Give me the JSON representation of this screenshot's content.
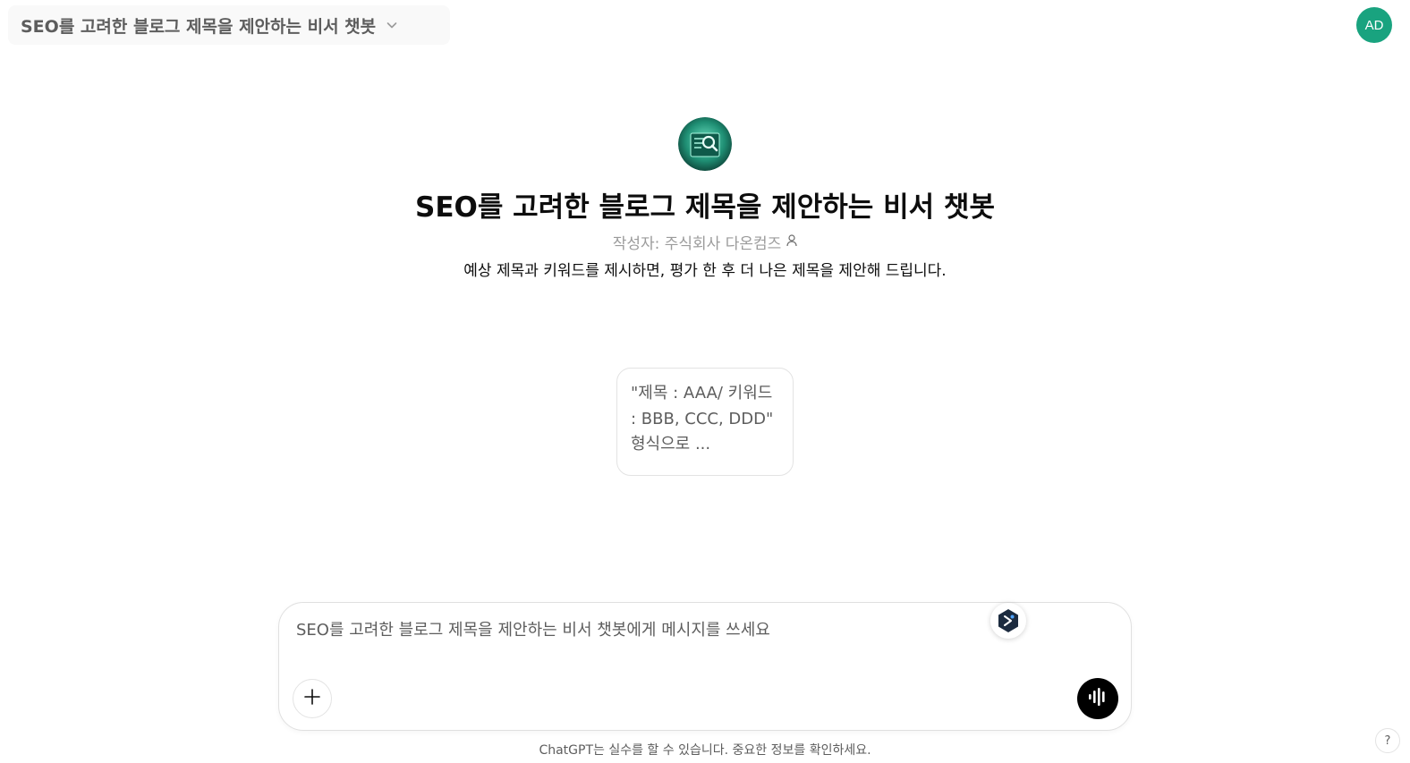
{
  "header": {
    "model_selector_label": "SEO를 고려한 블로그 제목을 제안하는 비서 챗봇",
    "avatar_initials": "AD",
    "avatar_color": "#19a37f"
  },
  "gpt": {
    "title": "SEO를 고려한 블로그 제목을 제안하는 비서 챗봇",
    "author": "작성자: 주식회사 다온컴즈",
    "description": "예상 제목과 키워드를 제시하면, 평가 한 후 더 나은 제목을 제안해 드립니다.",
    "logo_icon": "magnifier-document-logo"
  },
  "starters": [
    {
      "text": "\"제목 : AAA/ 키워드 : BBB, CCC, DDD\" 형식으로 ..."
    }
  ],
  "composer": {
    "placeholder": "SEO를 고려한 블로그 제목을 제안하는 비서 챗봇에게 메시지를 쓰세요",
    "value": "",
    "attach_icon": "plus-icon",
    "voice_icon": "voice-waveform-icon",
    "extension_icon": "extension-badge-icon"
  },
  "footer": {
    "disclaimer": "ChatGPT는 실수를 할 수 있습니다. 중요한 정보를 확인하세요.",
    "help_label": "?"
  }
}
